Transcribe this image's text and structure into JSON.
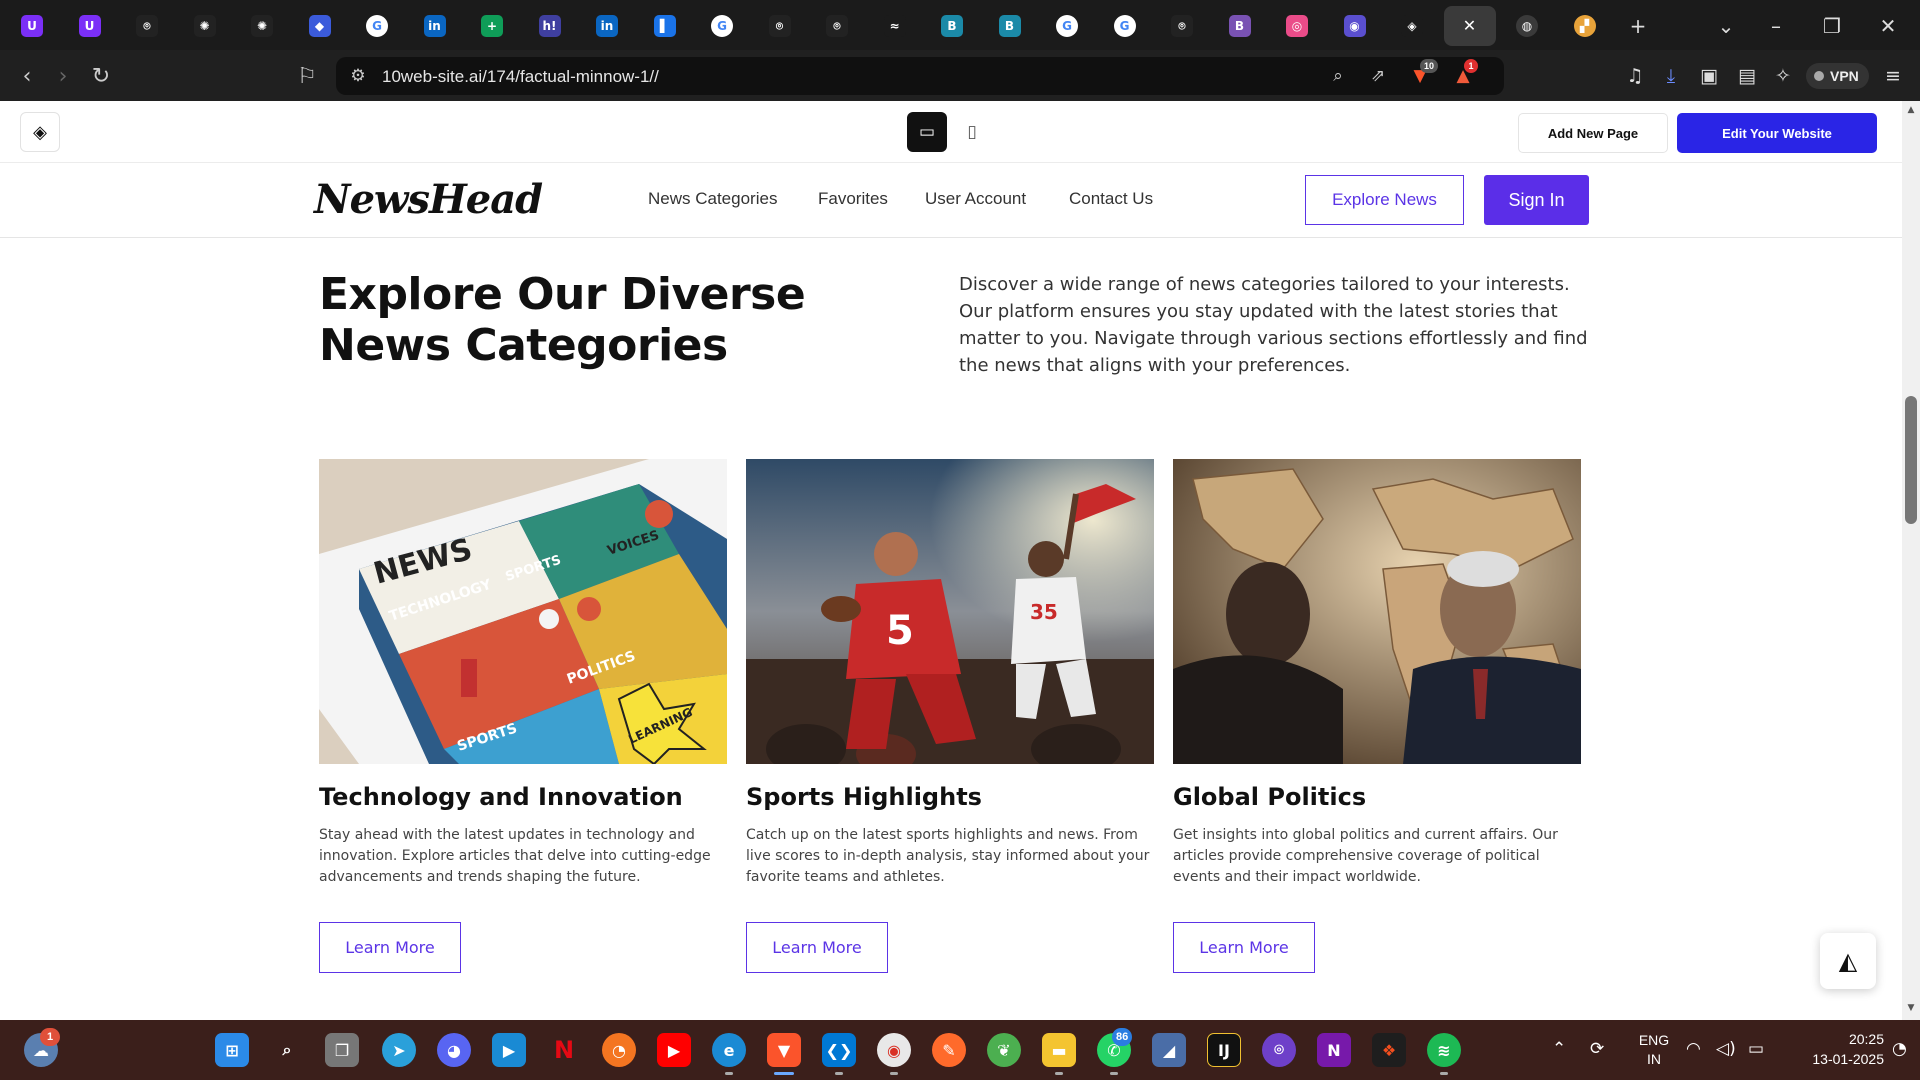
{
  "browser": {
    "tabs": [
      {
        "name": "uphold-tab-1",
        "glyph": "U",
        "color": "#7b2ff7"
      },
      {
        "name": "uphold-tab-2",
        "glyph": "U",
        "color": "#7b2ff7"
      },
      {
        "name": "github-tab-1",
        "glyph": "⌾",
        "color": "#222222"
      },
      {
        "name": "openai-tab-1",
        "glyph": "✺",
        "color": "#222222"
      },
      {
        "name": "openai-tab-2",
        "glyph": "✺",
        "color": "#222222"
      },
      {
        "name": "bitwarden-tab",
        "glyph": "◆",
        "color": "#3b5bdb"
      },
      {
        "name": "google-tab-1",
        "glyph": "G",
        "color": "#ffffff"
      },
      {
        "name": "linkedin-tab-1",
        "glyph": "in",
        "color": "#0a66c2"
      },
      {
        "name": "sheets-tab",
        "glyph": "+",
        "color": "#0f9d58"
      },
      {
        "name": "hashnode-tab",
        "glyph": "h!",
        "color": "#3f3fa0"
      },
      {
        "name": "linkedin-tab-2",
        "glyph": "in",
        "color": "#0a66c2"
      },
      {
        "name": "docs-tab",
        "glyph": "▌",
        "color": "#1a73e8"
      },
      {
        "name": "google-tab-2",
        "glyph": "G",
        "color": "#ffffff"
      },
      {
        "name": "github-tab-2",
        "glyph": "⌾",
        "color": "#222222"
      },
      {
        "name": "github-tab-3",
        "glyph": "⌾",
        "color": "#222222"
      },
      {
        "name": "codepen-tab",
        "glyph": "≈",
        "color": "#1b1b1b"
      },
      {
        "name": "bolt-tab-1",
        "glyph": "B",
        "color": "#1b8aa8"
      },
      {
        "name": "bolt-tab-2",
        "glyph": "B",
        "color": "#1b8aa8"
      },
      {
        "name": "google-tab-3",
        "glyph": "G",
        "color": "#ffffff"
      },
      {
        "name": "google-tab-4",
        "glyph": "G",
        "color": "#ffffff"
      },
      {
        "name": "github-tab-4",
        "glyph": "⌾",
        "color": "#222222"
      },
      {
        "name": "bootstrap-tab",
        "glyph": "B",
        "color": "#7952b3"
      },
      {
        "name": "dribbble-tab",
        "glyph": "◎",
        "color": "#ea4c89"
      },
      {
        "name": "app-tab",
        "glyph": "◉",
        "color": "#5a4fcf"
      },
      {
        "name": "tenweb-tab",
        "glyph": "◈",
        "color": "#1b1b1b"
      }
    ],
    "active_tab_close": "✕",
    "extra_tabs": [
      {
        "name": "globe-tab",
        "glyph": "◍",
        "color": "#3a3a3a"
      },
      {
        "name": "colorful-tab",
        "glyph": "▞",
        "color": "#e8a33a"
      }
    ],
    "new_tab": "+",
    "url": "10web-site.ai/174/factual-minnow-1//",
    "brave_badge": "10",
    "alert_badge": "1",
    "vpn_label": "VPN"
  },
  "editor": {
    "add_page": "Add New Page",
    "edit_website": "Edit Your Website"
  },
  "site": {
    "brand": "NewsHead",
    "nav": [
      "News Categories",
      "Favorites",
      "User Account",
      "Contact Us"
    ],
    "explore_button": "Explore News",
    "signin_button": "Sign In",
    "hero_title": "Explore Our Diverse News Categories",
    "hero_description": "Discover a wide range of news categories tailored to your interests. Our platform ensures you stay updated with the latest stories that matter to you. Navigate through various sections effortlessly and find the news that aligns with your preferences.",
    "cards": [
      {
        "title": "Technology and Innovation",
        "description": "Stay ahead with the latest updates in technology and innovation. Explore articles that delve into cutting-edge advancements and trends shaping the future.",
        "button": "Learn More",
        "image_words": [
          "NEWS",
          "TECHNOLOGY",
          "SPORTS",
          "VOICES",
          "POLITICS",
          "SPORTS",
          "LEARNING"
        ]
      },
      {
        "title": "Sports Highlights",
        "description": "Catch up on the latest sports highlights and news. From live scores to in-depth analysis, stay informed about your favorite teams and athletes.",
        "button": "Learn More",
        "image_words": [
          "5",
          "35"
        ]
      },
      {
        "title": "Global Politics",
        "description": "Get insights into global politics and current affairs. Our articles provide comprehensive coverage of political events and their impact worldwide.",
        "button": "Learn More",
        "image_words": []
      }
    ]
  },
  "taskbar": {
    "weather_badge": "1",
    "whatsapp_badge": "86",
    "lang_top": "ENG",
    "lang_bottom": "IN",
    "time": "20:25",
    "date": "13-01-2025"
  }
}
